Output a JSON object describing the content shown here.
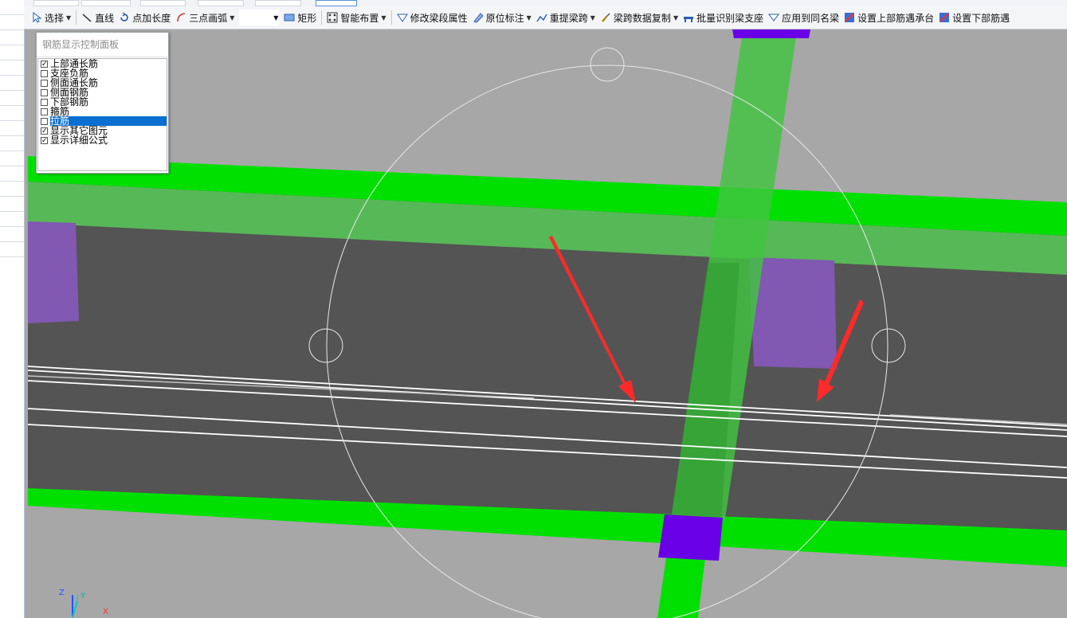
{
  "toolbar": {
    "items": [
      {
        "label": "选择",
        "icon": "cursor-arrow-icon",
        "dropdown": true
      },
      {
        "label": "直线",
        "icon": "line-icon"
      },
      {
        "label": "点加长度",
        "icon": "point-length-icon"
      },
      {
        "label": "三点画弧",
        "icon": "arc-icon",
        "dropdown": true
      },
      {
        "label": "矩形",
        "icon": "rectangle-icon"
      },
      {
        "label": "智能布置",
        "icon": "smart-layout-icon",
        "dropdown": true
      },
      {
        "label": "修改梁段属性",
        "icon": "modify-beam-icon"
      },
      {
        "label": "原位标注",
        "icon": "in-situ-annotation-icon",
        "dropdown": true
      },
      {
        "label": "重提梁跨",
        "icon": "respan-icon",
        "dropdown": true
      },
      {
        "label": "梁跨数据复制",
        "icon": "brush-icon",
        "dropdown": true
      },
      {
        "label": "批量识别梁支座",
        "icon": "batch-identify-icon"
      },
      {
        "label": "应用到同名梁",
        "icon": "apply-icon"
      },
      {
        "label": "设置上部筋遇承台",
        "icon": "set-top-rebar-icon"
      },
      {
        "label": "设置下部筋遇",
        "icon": "set-bottom-rebar-icon"
      }
    ]
  },
  "rebar_panel": {
    "title": "钢筋显示控制面板",
    "options": [
      {
        "label": "上部通长筋",
        "checked": true,
        "selected": false
      },
      {
        "label": "支座负筋",
        "checked": false,
        "selected": false
      },
      {
        "label": "侧面通长筋",
        "checked": false,
        "selected": false
      },
      {
        "label": "侧面钢筋",
        "checked": false,
        "selected": false
      },
      {
        "label": "下部钢筋",
        "checked": false,
        "selected": false
      },
      {
        "label": "箍筋",
        "checked": false,
        "selected": false
      },
      {
        "label": "拉筋",
        "checked": false,
        "selected": true
      },
      {
        "label": "显示其它图元",
        "checked": true,
        "selected": false
      },
      {
        "label": "显示详细公式",
        "checked": true,
        "selected": false
      }
    ]
  },
  "axes": {
    "z": "Z",
    "y": "Y",
    "x": "X"
  },
  "colors": {
    "background": "#a7a7a7",
    "beam_dark": "#545454",
    "beam_green": "#00e000",
    "transparent_green": "#57b857",
    "purple_column": "#8158b2",
    "violet_block": "#6a00e6",
    "arrow_red": "#ff2a2a",
    "rebar_line": "#ffffff"
  }
}
